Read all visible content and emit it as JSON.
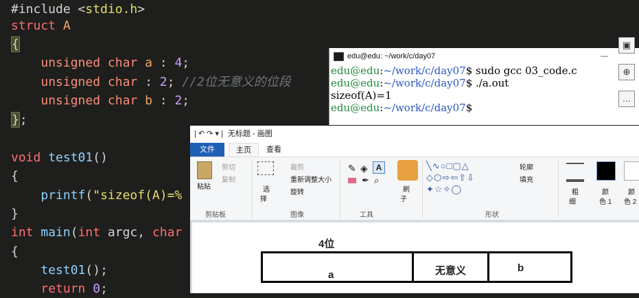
{
  "code": {
    "include_kw": "#include",
    "include_hdr_open": "<",
    "include_hdr": "stdio.h",
    "include_hdr_close": ">",
    "struct_kw": "struct",
    "struct_name": "A",
    "open_brace": "{",
    "f1_type": "unsigned char",
    "f1_name": "a",
    "f1_rest": " : ",
    "f1_bits": "4",
    "f1_end": ";",
    "f2_type": "unsigned char",
    "f2_rest": " : ",
    "f2_bits": "2",
    "f2_end": ";",
    "f2_comment": " //2位无意义的位段",
    "f3_type": "unsigned char",
    "f3_name": "b",
    "f3_rest": " : ",
    "f3_bits": "2",
    "f3_end": ";",
    "close_brace": "}",
    "close_semi": ";",
    "void_kw": "void",
    "fn_test": "test01",
    "fn_parens": "()",
    "brace_open2": "{",
    "printf": "printf",
    "printf_rest": "(",
    "printf_str": "\"sizeof(A)=%",
    "brace_close2": "}",
    "int_kw": "int",
    "main_fn": "main",
    "main_rest1": "(",
    "int_kw2": "int",
    "argc": " argc, ",
    "char_kw": "char",
    "brace_open3": "{",
    "call_test": "test01",
    "call_rest": "();",
    "return_kw": "return",
    "return_val": "0",
    "return_end": ";"
  },
  "terminal": {
    "title": "edu@edu: ~/work/c/day07",
    "controls": "—",
    "lines": [
      {
        "user": "edu@edu",
        "colon": ":",
        "path": "~/work/c/day07",
        "cmd": "$ sudo gcc 03_code.c"
      },
      {
        "user": "edu@edu",
        "colon": ":",
        "path": "~/work/c/day07",
        "cmd": "$ ./a.out"
      },
      {
        "output": "sizeof(A)=1"
      },
      {
        "user": "edu@edu",
        "colon": ":",
        "path": "~/work/c/day07",
        "cmd": "$"
      }
    ],
    "side_buttons": [
      "▣",
      "⊕",
      "…"
    ]
  },
  "paint": {
    "title": "无标题 - 画图",
    "quick": "| ↶ ↷ ▾ |",
    "tabs": {
      "file": "文件",
      "home": "主页",
      "view": "查看"
    },
    "clipboard": {
      "paste": "粘贴",
      "cut": "剪切",
      "copy": "复制",
      "label": "剪贴板"
    },
    "image": {
      "select": "选",
      "select2": "择",
      "crop": "裁剪",
      "resize": "重新调整大小",
      "rotate": "旋转",
      "label": "图像"
    },
    "tools": {
      "label": "工具"
    },
    "brush": {
      "label1": "刷",
      "label2": "子"
    },
    "shapes": {
      "outline": "轮廓",
      "fill": "填充",
      "label": "形状"
    },
    "size": {
      "label1": "粗",
      "label2": "细"
    },
    "color1": {
      "label1": "颜",
      "label2": "色 1"
    },
    "color2": {
      "label1": "颜",
      "label2": "色 2"
    },
    "diagram": {
      "title": "4位",
      "a": "a",
      "mid": "无意义",
      "b": "b"
    }
  },
  "colors": {
    "accent": "#1e5fb6",
    "editor_bg": "#1e1f1c"
  }
}
